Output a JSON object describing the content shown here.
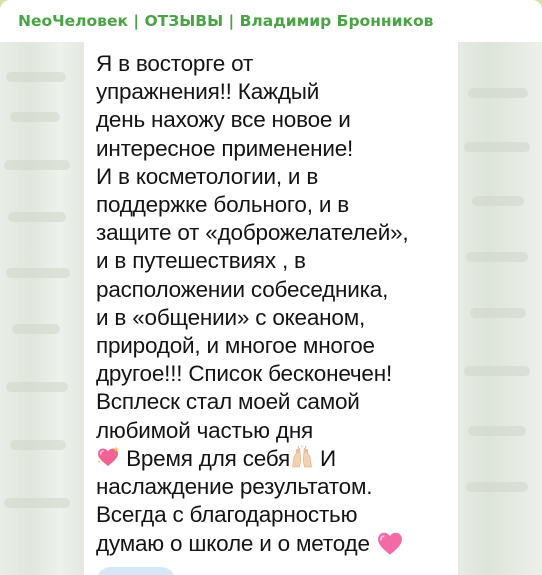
{
  "header": {
    "title": "NeoЧеловек | ОТЗЫВЫ | Владимир Бронников"
  },
  "message": {
    "lines": [
      "Я в восторге от",
      "упражнения!! Каждый",
      "день нахожу все новое и",
      "интересное применение!",
      "И в косметологии, и в",
      "поддержке больного, и в",
      "защите от «доброжелателей»,",
      "и в путешествиях , в",
      "расположении собеседника,",
      "и в «общении» с океаном,",
      "природой, и многое многое",
      "другое!!! Список бесконечен!",
      "Всплеск стал моей самой",
      "любимой частью дня"
    ],
    "line15_part1": "Время для себя",
    "line15_part2": "И",
    "line16": "наслаждение результатом.",
    "line17": "Всегда с благодарностью",
    "line18": "думаю о школе и о методе"
  },
  "icons": {
    "heart_sparkle": "sparkling-heart-icon",
    "raised_hands": "raised-hands-icon",
    "pink_heart": "pink-heart-icon"
  },
  "colors": {
    "channel_title": "#4aa344",
    "text": "#141414",
    "pink": "#e8457f"
  }
}
